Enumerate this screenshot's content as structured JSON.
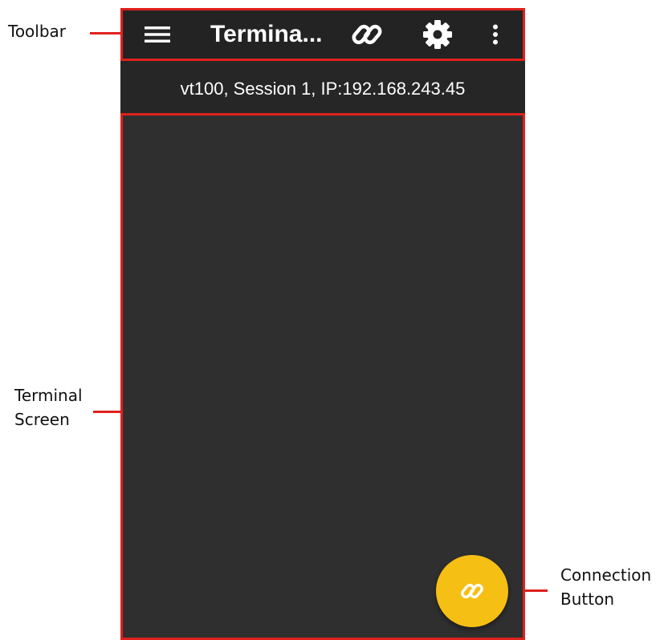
{
  "app": {
    "title": "Termina...",
    "session_info": "vt100, Session 1, IP:192.168.243.45",
    "toolbar_icons": [
      "menu-icon",
      "link-icon",
      "gear-icon",
      "more-vert-icon"
    ],
    "fab_icon": "link-icon"
  },
  "annotations": {
    "toolbar": "Toolbar",
    "terminal_line1": "Terminal",
    "terminal_line2": "Screen",
    "connection_line1": "Connection",
    "connection_line2": "Button"
  },
  "colors": {
    "annotation_red": "#e0201c",
    "toolbar_bg": "#232323",
    "terminal_bg": "#2f2f2f",
    "fab_yellow": "#f6bf14",
    "fab_icon": "#ffffff"
  }
}
